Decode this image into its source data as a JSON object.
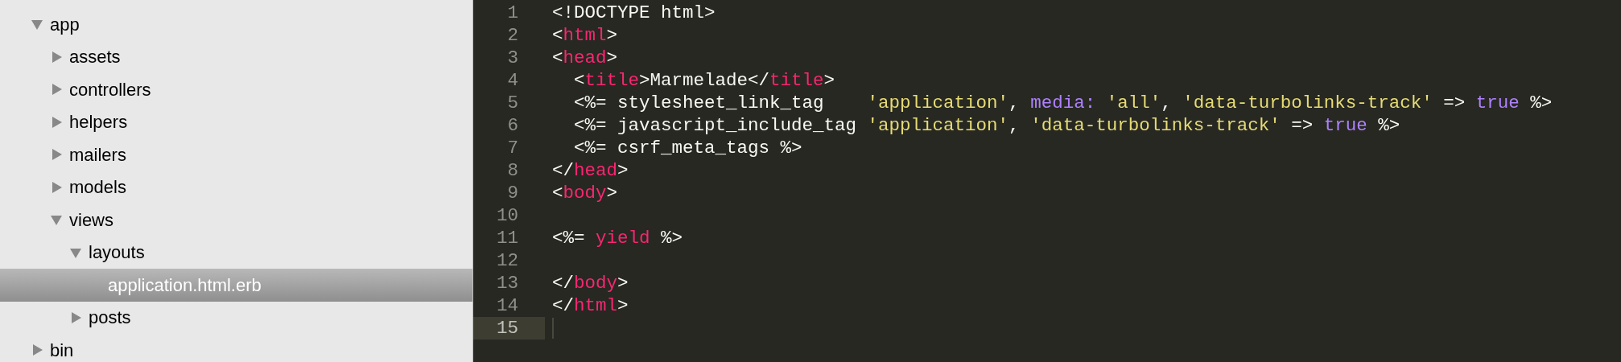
{
  "sidebar": {
    "tree": [
      {
        "label": "app",
        "kind": "folder",
        "expanded": true,
        "selected": false,
        "children": [
          {
            "label": "assets",
            "kind": "folder",
            "expanded": false,
            "selected": false
          },
          {
            "label": "controllers",
            "kind": "folder",
            "expanded": false,
            "selected": false
          },
          {
            "label": "helpers",
            "kind": "folder",
            "expanded": false,
            "selected": false
          },
          {
            "label": "mailers",
            "kind": "folder",
            "expanded": false,
            "selected": false
          },
          {
            "label": "models",
            "kind": "folder",
            "expanded": false,
            "selected": false
          },
          {
            "label": "views",
            "kind": "folder",
            "expanded": true,
            "selected": false,
            "children": [
              {
                "label": "layouts",
                "kind": "folder",
                "expanded": true,
                "selected": false,
                "children": [
                  {
                    "label": "application.html.erb",
                    "kind": "file",
                    "selected": true
                  }
                ]
              },
              {
                "label": "posts",
                "kind": "folder",
                "expanded": false,
                "selected": false
              }
            ]
          }
        ]
      },
      {
        "label": "bin",
        "kind": "folder",
        "expanded": false,
        "selected": false
      }
    ]
  },
  "editor": {
    "lines": [
      {
        "number": "1",
        "current": false,
        "tokens": [
          {
            "text": "<!DOCTYPE html>",
            "kind": "plain"
          }
        ]
      },
      {
        "number": "2",
        "current": false,
        "tokens": [
          {
            "text": "<",
            "kind": "plain"
          },
          {
            "text": "html",
            "kind": "tag"
          },
          {
            "text": ">",
            "kind": "plain"
          }
        ]
      },
      {
        "number": "3",
        "current": false,
        "tokens": [
          {
            "text": "<",
            "kind": "plain"
          },
          {
            "text": "head",
            "kind": "tag"
          },
          {
            "text": ">",
            "kind": "plain"
          }
        ]
      },
      {
        "number": "4",
        "current": false,
        "tokens": [
          {
            "text": "  <",
            "kind": "plain"
          },
          {
            "text": "title",
            "kind": "tag"
          },
          {
            "text": ">Marmelade</",
            "kind": "plain"
          },
          {
            "text": "title",
            "kind": "tag"
          },
          {
            "text": ">",
            "kind": "plain"
          }
        ]
      },
      {
        "number": "5",
        "current": false,
        "tokens": [
          {
            "text": "  <%= stylesheet_link_tag    ",
            "kind": "plain"
          },
          {
            "text": "'application'",
            "kind": "string"
          },
          {
            "text": ", ",
            "kind": "plain"
          },
          {
            "text": "media:",
            "kind": "constant"
          },
          {
            "text": " 'all'",
            "kind": "string"
          },
          {
            "text": ", ",
            "kind": "plain"
          },
          {
            "text": "'data-turbolinks-track'",
            "kind": "string"
          },
          {
            "text": " => ",
            "kind": "plain"
          },
          {
            "text": "true",
            "kind": "constant"
          },
          {
            "text": " %>",
            "kind": "plain"
          }
        ]
      },
      {
        "number": "6",
        "current": false,
        "tokens": [
          {
            "text": "  <%= javascript_include_tag ",
            "kind": "plain"
          },
          {
            "text": "'application'",
            "kind": "string"
          },
          {
            "text": ", ",
            "kind": "plain"
          },
          {
            "text": "'data-turbolinks-track'",
            "kind": "string"
          },
          {
            "text": " => ",
            "kind": "plain"
          },
          {
            "text": "true",
            "kind": "constant"
          },
          {
            "text": " %>",
            "kind": "plain"
          }
        ]
      },
      {
        "number": "7",
        "current": false,
        "tokens": [
          {
            "text": "  <%= csrf_meta_tags %>",
            "kind": "plain"
          }
        ]
      },
      {
        "number": "8",
        "current": false,
        "tokens": [
          {
            "text": "</",
            "kind": "plain"
          },
          {
            "text": "head",
            "kind": "tag"
          },
          {
            "text": ">",
            "kind": "plain"
          }
        ]
      },
      {
        "number": "9",
        "current": false,
        "tokens": [
          {
            "text": "<",
            "kind": "plain"
          },
          {
            "text": "body",
            "kind": "tag"
          },
          {
            "text": ">",
            "kind": "plain"
          }
        ]
      },
      {
        "number": "10",
        "current": false
      },
      {
        "number": "11",
        "current": false,
        "tokens": [
          {
            "text": "<%= ",
            "kind": "plain"
          },
          {
            "text": "yield",
            "kind": "tag"
          },
          {
            "text": " %>",
            "kind": "plain"
          }
        ]
      },
      {
        "number": "12",
        "current": false
      },
      {
        "number": "13",
        "current": false,
        "tokens": [
          {
            "text": "</",
            "kind": "plain"
          },
          {
            "text": "body",
            "kind": "tag"
          },
          {
            "text": ">",
            "kind": "plain"
          }
        ]
      },
      {
        "number": "14",
        "current": false,
        "tokens": [
          {
            "text": "</",
            "kind": "plain"
          },
          {
            "text": "html",
            "kind": "tag"
          },
          {
            "text": ">",
            "kind": "plain"
          }
        ]
      },
      {
        "number": "15",
        "current": true
      }
    ]
  }
}
